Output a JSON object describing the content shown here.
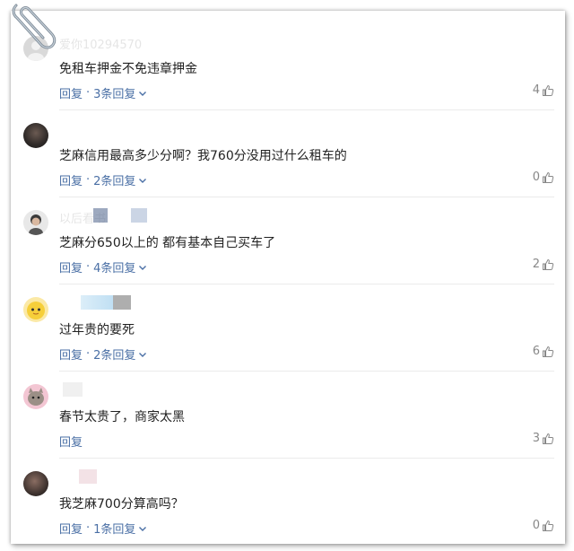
{
  "comments": [
    {
      "username": "爱你10294570",
      "content": "免租车押金不免违章押金",
      "reply_label": "回复",
      "reply_count_label": "3条回复",
      "likes": "4",
      "avatar": "gray-placeholder"
    },
    {
      "username": "",
      "content": "芝麻信用最高多少分啊？我760分没用过什么租车的",
      "reply_label": "回复",
      "reply_count_label": "2条回复",
      "likes": "0",
      "avatar": "dark-photo"
    },
    {
      "username": "以后看书",
      "content": "芝麻分650以上的 都有基本自己买车了",
      "reply_label": "回复",
      "reply_count_label": "4条回复",
      "likes": "2",
      "avatar": "person-photo"
    },
    {
      "username": "",
      "content": "过年贵的要死",
      "reply_label": "回复",
      "reply_count_label": "2条回复",
      "likes": "6",
      "avatar": "yellow-cartoon"
    },
    {
      "username": "",
      "content": "春节太贵了，商家太黑",
      "reply_label": "回复",
      "reply_count_label": "",
      "likes": "3",
      "avatar": "cat-photo"
    },
    {
      "username": "",
      "content": "我芝麻700分算高吗？",
      "reply_label": "回复",
      "reply_count_label": "1条回复",
      "likes": "0",
      "avatar": "dark-photo-2"
    }
  ],
  "colors": {
    "link": "#4a6fa5",
    "text": "#222222",
    "muted": "#888888",
    "divider": "#ebebeb"
  },
  "icons": {
    "like": "thumb-up-icon",
    "expand": "chevron-down-icon",
    "clip": "paperclip-icon"
  }
}
